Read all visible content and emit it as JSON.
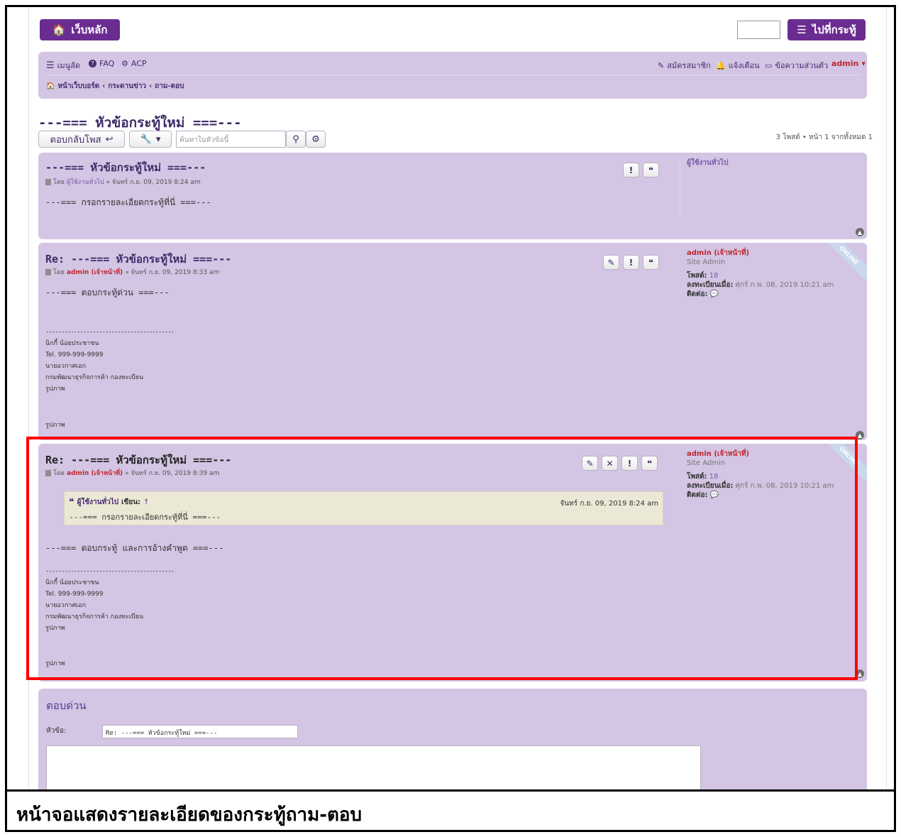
{
  "header": {
    "home_label": "เว็บหลัก",
    "goto_label": "ไปที่กระทู้"
  },
  "navbar": {
    "quick_links": "เมนูลัด",
    "faq": "FAQ",
    "acp": "ACP",
    "register": "สมัครสมาชิก",
    "notifications": "แจ้งเตือน",
    "private_messages": "ข้อความส่วนตัว",
    "username": "admin",
    "breadcrumbs": [
      "หน้าเว็บบอร์ด",
      "กระดานข่าว",
      "ถาม-ตอบ"
    ]
  },
  "topic": {
    "title": "---=== หัวข้อกระทู้ใหม่ ===---",
    "reply_button": "ตอบกลับโพส",
    "search_placeholder": "ค้นหาในหัวข้อนี้",
    "pagination": "3 โพสต์ • หน้า 1 จากทั้งหมด 1"
  },
  "posts": [
    {
      "title": "---=== หัวข้อกระทู้ใหม่ ===---",
      "meta_prefix": "โดย",
      "author": "ผู้ใช้งานทั่วไป",
      "meta_time": "» จันทร์ ก.ย. 09, 2019 8:24 am",
      "body": "---=== กรอกรายละเอียดกระทู้ที่นี่ ===---",
      "profile_name": "ผู้ใช้งานทั่วไป"
    },
    {
      "title": "Re: ---=== หัวข้อกระทู้ใหม่ ===---",
      "meta_prefix": "โดย",
      "author": "admin (เจ้าหน้าที่)",
      "meta_time": "» จันทร์ ก.ย. 09, 2019 8:33 am",
      "body": "---=== ตอบกระทู้ด่วน ===---",
      "signature": {
        "line": "-----------------------------------------",
        "name": "นิกกี้ น้อยประชาชน",
        "tel": "Tel. 999-999-9999",
        "rank": "นายอวกาศเอก",
        "dept": "กรมพัฒนาธุรกิจการค้า กองทะเบียน",
        "image1": "รูปภาพ",
        "image2": "รูปภาพ"
      },
      "profile": {
        "name": "admin (เจ้าหน้าที่)",
        "rank": "Site Admin",
        "posts_label": "โพสต์:",
        "posts_value": "18",
        "joined_label": "ลงทะเบียนเมื่อ:",
        "joined_value": "ศุกร์ ก.พ. 08, 2019 10:21 am",
        "contact_label": "ติดต่อ:"
      },
      "online": "ONLINE"
    },
    {
      "title": "Re: ---=== หัวข้อกระทู้ใหม่ ===---",
      "meta_prefix": "โดย",
      "author": "admin (เจ้าหน้าที่)",
      "meta_time": "» จันทร์ ก.ย. 09, 2019 8:39 am",
      "quote": {
        "author": "ผู้ใช้งานทั่วไป",
        "wrote": "เขียน:",
        "arrow": "↑",
        "time": "จันทร์ ก.ย. 09, 2019 8:24 am",
        "text": "---=== กรอกรายละเอียดกระทู้ที่นี่ ===---"
      },
      "body": "---=== ตอบกระทู้ และการอ้างคำพูด ===---",
      "signature": {
        "line": "-----------------------------------------",
        "name": "นิกกี้ น้อยประชาชน",
        "tel": "Tel. 999-999-9999",
        "rank": "นายอวกาศเอก",
        "dept": "กรมพัฒนาธุรกิจการค้า กองทะเบียน",
        "image1": "รูปภาพ",
        "image2": "รูปภาพ"
      },
      "profile": {
        "name": "admin (เจ้าหน้าที่)",
        "rank": "Site Admin",
        "posts_label": "โพสต์:",
        "posts_value": "18",
        "joined_label": "ลงทะเบียนเมื่อ:",
        "joined_value": "ศุกร์ ก.พ. 08, 2019 10:21 am",
        "contact_label": "ติดต่อ:"
      },
      "online": "ONLINE"
    }
  ],
  "quick_reply": {
    "title": "ตอบด่วน",
    "subject_label": "หัวข้อ:",
    "subject_value": "Re: ---=== หัวข้อกระทู้ใหม่ ===---"
  },
  "caption": "หน้าจอแสดงรายละเอียดของกระทู้ถาม-ตอบ",
  "colors": {
    "brand_purple": "#6a2c91",
    "panel_lavender": "#d3c5e3",
    "highlight_red": "#ff0000",
    "admin_red": "#c0262d"
  }
}
